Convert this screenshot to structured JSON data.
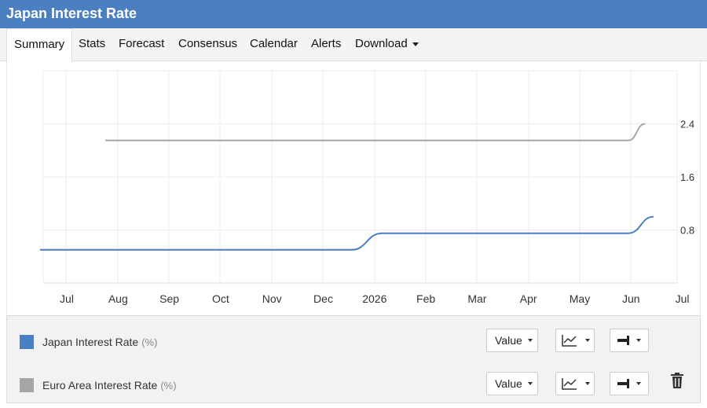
{
  "window": {
    "title": "Japan Interest Rate"
  },
  "tabs": [
    {
      "label": "Summary"
    },
    {
      "label": "Stats"
    },
    {
      "label": "Forecast"
    },
    {
      "label": "Consensus"
    },
    {
      "label": "Calendar"
    },
    {
      "label": "Alerts"
    },
    {
      "label": "Download"
    }
  ],
  "legend": {
    "series": [
      {
        "name": "Japan Interest Rate",
        "unit": "(%)",
        "color": "#4a7fc1",
        "value_label": "Value"
      },
      {
        "name": "Euro Area Interest Rate",
        "unit": "(%)",
        "color": "#a6a6a6",
        "value_label": "Value"
      }
    ]
  },
  "colors": {
    "accent": "#4a7fc1",
    "series_gray": "#a6a6a6"
  },
  "chart_data": {
    "type": "line",
    "title": "",
    "xlabel": "",
    "ylabel": "",
    "x_ticks": [
      "Jul",
      "Aug",
      "Sep",
      "Oct",
      "Nov",
      "Dec",
      "2026",
      "Feb",
      "Mar",
      "Apr",
      "May",
      "Jun",
      "Jul"
    ],
    "y_ticks": [
      0.8,
      1.6,
      2.4
    ],
    "ylim": [
      0,
      3.2
    ],
    "grid": true,
    "y_axis_side": "right",
    "series": [
      {
        "name": "Japan Interest Rate",
        "color": "#4a7fc1",
        "points": [
          {
            "x": "2025-06-15",
            "y": 0.5
          },
          {
            "x": "2025-12-18",
            "y": 0.5
          },
          {
            "x": "2026-01-05",
            "y": 0.75
          },
          {
            "x": "2026-06-01",
            "y": 0.75
          },
          {
            "x": "2026-06-16",
            "y": 1.0
          }
        ]
      },
      {
        "name": "Euro Area Interest Rate",
        "color": "#a6a6a6",
        "points": [
          {
            "x": "2025-07-24",
            "y": 2.15
          },
          {
            "x": "2026-06-01",
            "y": 2.15
          },
          {
            "x": "2026-06-11",
            "y": 2.4
          }
        ]
      }
    ]
  },
  "icons": {
    "chart_type": "line-chart-icon",
    "style": "bar-style-icon",
    "delete": "trash-icon"
  }
}
